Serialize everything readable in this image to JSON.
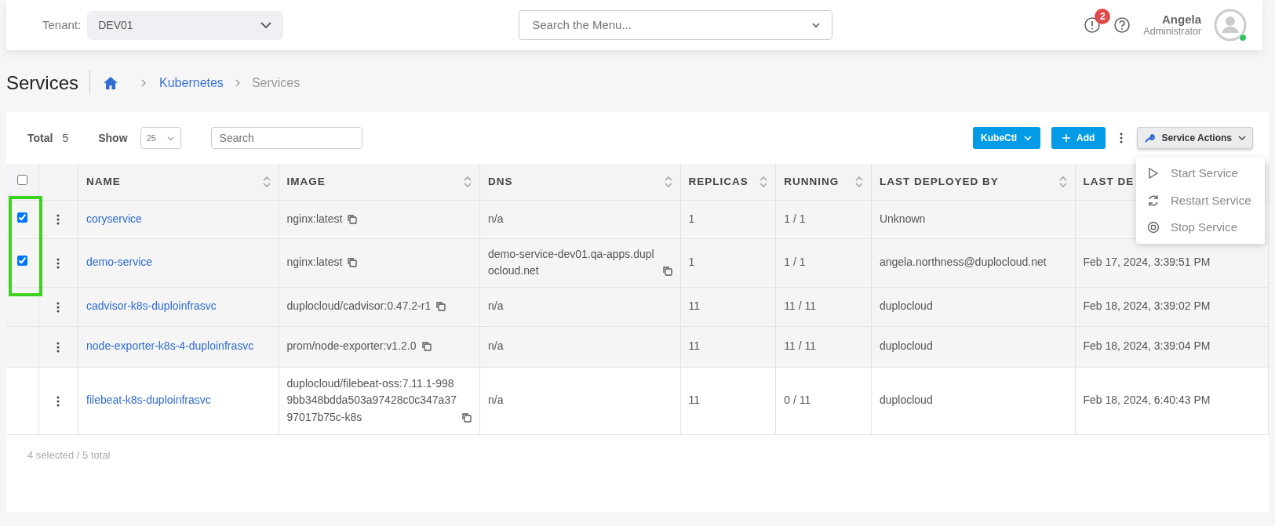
{
  "header": {
    "tenant_label": "Tenant:",
    "tenant_value": "DEV01",
    "menu_search": {
      "placeholder": "Search the Menu..."
    },
    "alerts_badge": "2",
    "user": {
      "name": "Angela",
      "role": "Administrator",
      "online": true
    }
  },
  "page": {
    "title": "Services",
    "breadcrumb": [
      {
        "label": "Kubernetes",
        "link": true
      },
      {
        "label": "Services",
        "link": false
      }
    ]
  },
  "toolbar": {
    "total_label": "Total",
    "total_value": "5",
    "show_label": "Show",
    "show_value": "25",
    "search": {
      "placeholder": "Search"
    },
    "kubectl": "KubeCtl",
    "add": "Add",
    "actions": "Service Actions"
  },
  "actions_menu": [
    {
      "label": "Start Service",
      "kind": "play"
    },
    {
      "label": "Restart Service",
      "kind": "restart"
    },
    {
      "label": "Stop Service",
      "kind": "stop"
    }
  ],
  "table": {
    "select_all": {
      "checked": false
    },
    "columns": [
      {
        "label": "NAME",
        "sortable": true
      },
      {
        "label": "IMAGE",
        "sortable": true
      },
      {
        "label": "DNS",
        "sortable": true
      },
      {
        "label": "REPLICAS",
        "sortable": true
      },
      {
        "label": "RUNNING",
        "sortable": true
      },
      {
        "label": "LAST DEPLOYED BY",
        "sortable": true
      },
      {
        "label": "LAST DE"
      }
    ],
    "rows": [
      {
        "checkbox": {
          "checked": true
        },
        "name": "coryservice",
        "image": {
          "text": "nginx:latest",
          "copyable": true
        },
        "dns": {
          "text": "n/a",
          "copyable": false
        },
        "replicas": "1",
        "running": "1 / 1",
        "deployed_by": "Unknown"
      },
      {
        "checkbox": {
          "checked": true
        },
        "name": "demo-service",
        "image": {
          "text": "nginx:latest",
          "copyable": true
        },
        "dns": {
          "text": "demo-service-dev01.qa-apps.duplocloud.net",
          "copyable": true
        },
        "replicas": "1",
        "running": "1 / 1",
        "deployed_by": "angela.northness@duplocloud.net",
        "deployed_at": "Feb 17, 2024, 3:39:51 PM"
      },
      {
        "name": "cadvisor-k8s-duploinfrasvc",
        "image": {
          "text": "duplocloud/cadvisor:0.47.2-r1",
          "copyable": true
        },
        "dns": {
          "text": "n/a",
          "copyable": false
        },
        "replicas": "11",
        "running": "11 / 11",
        "deployed_by": "duplocloud",
        "deployed_at": "Feb 18, 2024, 3:39:02 PM"
      },
      {
        "name": "node-exporter-k8s-4-duploinfrasvc",
        "image": {
          "text": "prom/node-exporter:v1.2.0",
          "copyable": true
        },
        "dns": {
          "text": "n/a",
          "copyable": false
        },
        "replicas": "11",
        "running": "11 / 11",
        "deployed_by": "duplocloud",
        "deployed_at": "Feb 18, 2024, 3:39:04 PM"
      },
      {
        "name": "filebeat-k8s-duploinfrasvc",
        "image": {
          "text": "duplocloud/filebeat-oss:7.11.1-9989bb348bdda503a97428c0c347a3797017b75c-k8s",
          "copyable": true
        },
        "dns": {
          "text": "n/a",
          "copyable": false
        },
        "replicas": "11",
        "running": "0 / 11",
        "deployed_by": "duplocloud",
        "deployed_at": "Feb 18, 2024, 6:40:43 PM"
      }
    ]
  },
  "footer": "4 selected / 5 total",
  "highlight": {
    "shown": true
  }
}
